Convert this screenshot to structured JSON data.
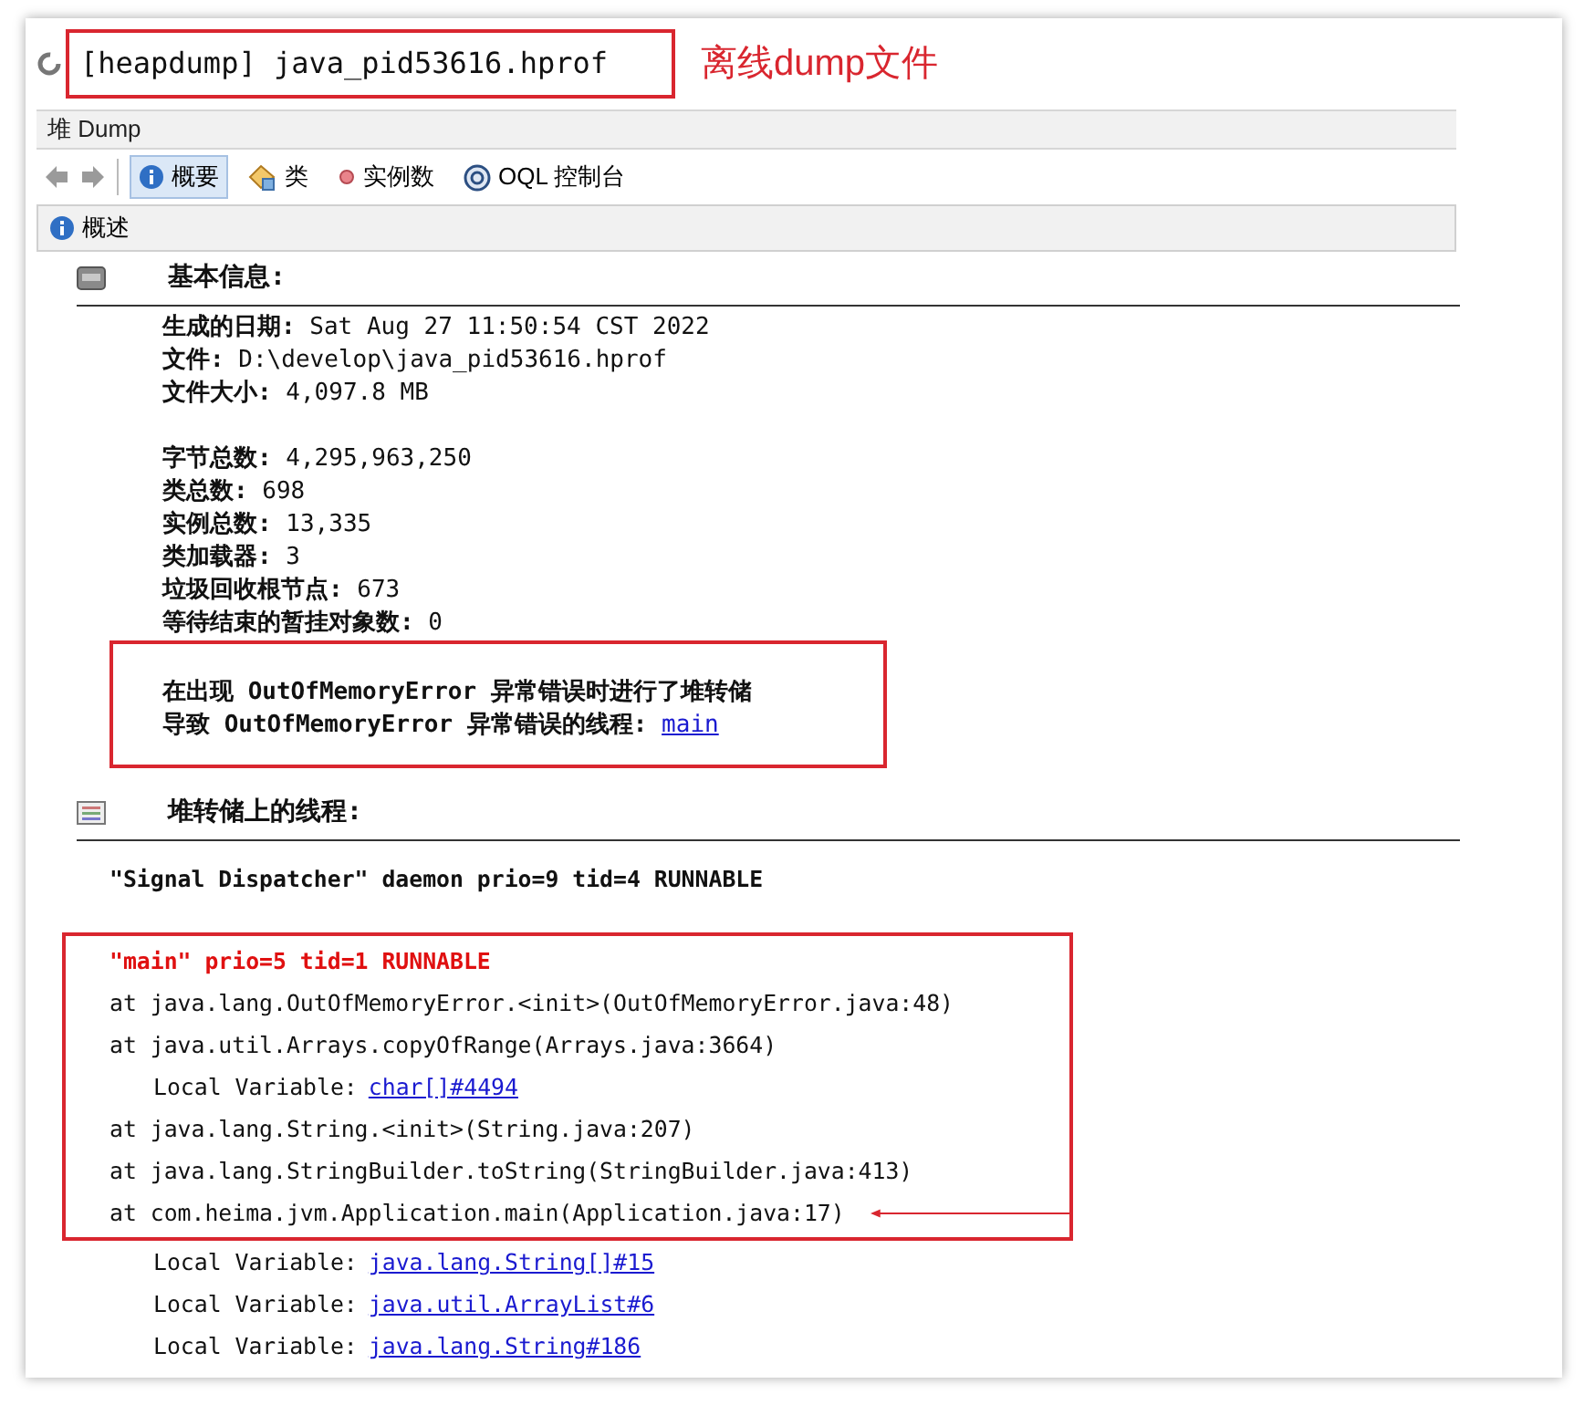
{
  "window": {
    "title": "[heapdump] java_pid53616.hprof",
    "annotation": "离线dump文件"
  },
  "tab": {
    "label": "堆 Dump"
  },
  "toolbar": {
    "items": [
      {
        "kind": "info",
        "label": "概要",
        "selected": true
      },
      {
        "kind": "classes",
        "label": "类",
        "selected": false
      },
      {
        "kind": "instances",
        "label": "实例数",
        "selected": false
      },
      {
        "kind": "oql",
        "label": "OQL 控制台",
        "selected": false
      }
    ]
  },
  "section": {
    "title": "概述"
  },
  "basic_info": {
    "heading": "基本信息:",
    "groups": [
      [
        {
          "label": "生成的日期:",
          "value": "Sat Aug 27 11:50:54 CST 2022"
        },
        {
          "label": "文件:",
          "value": "D:\\develop\\java_pid53616.hprof"
        },
        {
          "label": "文件大小:",
          "value": "4,097.8 MB"
        }
      ],
      [
        {
          "label": "字节总数:",
          "value": "4,295,963,250"
        },
        {
          "label": "类总数:",
          "value": "698"
        },
        {
          "label": "实例总数:",
          "value": "13,335"
        },
        {
          "label": "类加载器:",
          "value": "3"
        },
        {
          "label": "垃圾回收根节点:",
          "value": "673"
        },
        {
          "label": "等待结束的暂挂对象数:",
          "value": "0"
        }
      ]
    ],
    "oom_note": {
      "line1": "在出现 OutOfMemoryError 异常错误时进行了堆转储",
      "line2": "导致 OutOfMemoryError 异常错误的线程:",
      "link": "main"
    }
  },
  "threads": {
    "heading": "堆转储上的线程:",
    "list": [
      {
        "header": "\"Signal Dispatcher\" daemon prio=9 tid=4 RUNNABLE",
        "highlighted": false
      },
      {
        "header": "\"main\" prio=5 tid=1 RUNNABLE",
        "highlighted": true,
        "lines": [
          {
            "kind": "frame",
            "text": "at java.lang.OutOfMemoryError.<init>(OutOfMemoryError.java:48)"
          },
          {
            "kind": "frame",
            "text": "at java.util.Arrays.copyOfRange(Arrays.java:3664)"
          },
          {
            "kind": "local",
            "text": "Local Variable:",
            "link": "char[]#4494"
          },
          {
            "kind": "frame",
            "text": "at java.lang.String.<init>(String.java:207)"
          },
          {
            "kind": "frame",
            "text": "at java.lang.StringBuilder.toString(StringBuilder.java:413)"
          },
          {
            "kind": "frame",
            "text": "at com.heima.jvm.Application.main(Application.java:17)",
            "pointed": true
          },
          {
            "kind": "local",
            "text": "Local Variable:",
            "link": "java.lang.String[]#15"
          },
          {
            "kind": "local",
            "text": "Local Variable:",
            "link": "java.util.ArrayList#6"
          },
          {
            "kind": "local",
            "text": "Local Variable:",
            "link": "java.lang.String#186"
          }
        ]
      }
    ]
  }
}
